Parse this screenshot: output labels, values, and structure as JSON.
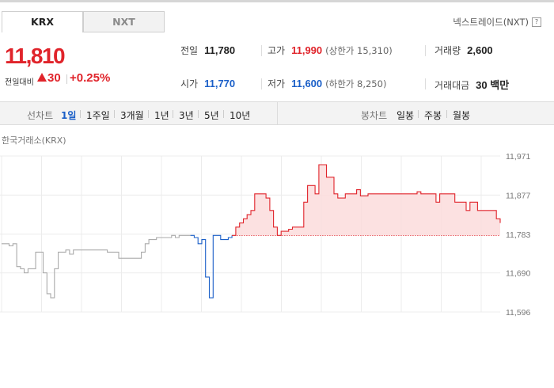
{
  "tabs": {
    "krx": "KRX",
    "nxt": "NXT"
  },
  "nxt_link": {
    "label": "넥스트레이드(NXT)",
    "icon": "?"
  },
  "quote": {
    "price": "11,810",
    "change_label": "전일대비",
    "change_value": "30",
    "change_pct": "+0.25%",
    "up_color": "#e0242b",
    "down_color": "#1a5fc8"
  },
  "stats": {
    "prev_close": {
      "label": "전일",
      "value": "11,780"
    },
    "high": {
      "label": "고가",
      "value": "11,990",
      "sub": "(상한가 15,310)"
    },
    "volume": {
      "label": "거래량",
      "value": "2,600"
    },
    "open": {
      "label": "시가",
      "value": "11,770"
    },
    "low": {
      "label": "저가",
      "value": "11,600",
      "sub": "(하한가 8,250)"
    },
    "amount": {
      "label": "거래대금",
      "value": "30 백만"
    }
  },
  "toolbar": {
    "line_label": "선차트",
    "line_periods": [
      "1일",
      "1주일",
      "3개월",
      "1년",
      "3년",
      "5년",
      "10년"
    ],
    "active_period": "1일",
    "candle_label": "봉차트",
    "candle_periods": [
      "일봉",
      "주봉",
      "월봉"
    ]
  },
  "exchange_label": "한국거래소(KRX)",
  "chart_data": {
    "type": "line",
    "title": "",
    "y_ticks": [
      "11,971",
      "11,877",
      "11,783",
      "11,690",
      "11,596"
    ],
    "ylim": [
      11596,
      11971
    ],
    "baseline": 11780,
    "grid": true,
    "series": [
      {
        "name": "",
        "segment": "before-session",
        "color": "#aaaaaa",
        "values": [
          11760,
          11760,
          11755,
          11760,
          11705,
          11700,
          11690,
          11700,
          11700,
          11740,
          11740,
          11690,
          11640,
          11630,
          11700,
          11740,
          11740,
          11745,
          11735,
          11745,
          11745,
          11745,
          11745,
          11745,
          11745,
          11745,
          11745,
          11745,
          11740,
          11740,
          11740,
          11725,
          11725,
          11725,
          11725,
          11725,
          11725,
          11740,
          11760,
          11770,
          11770,
          11775,
          11775,
          11775,
          11775,
          11780,
          11775,
          11780,
          11780,
          11780,
          11780
        ]
      },
      {
        "name": "",
        "segment": "open-dip",
        "color": "#1a5fc8",
        "values": [
          11780,
          11775,
          11760,
          11770,
          11680,
          11630,
          11780,
          11780,
          11770,
          11770,
          11775,
          11780
        ]
      },
      {
        "name": "",
        "segment": "session",
        "color": "#e0242b",
        "values": [
          11780,
          11800,
          11810,
          11820,
          11830,
          11840,
          11880,
          11880,
          11880,
          11870,
          11840,
          11800,
          11780,
          11790,
          11790,
          11795,
          11800,
          11800,
          11800,
          11860,
          11900,
          11900,
          11880,
          11950,
          11950,
          11920,
          11920,
          11880,
          11870,
          11870,
          11880,
          11880,
          11880,
          11890,
          11875,
          11875,
          11880,
          11880,
          11880,
          11880,
          11880,
          11880,
          11880,
          11880,
          11880,
          11880,
          11880,
          11880,
          11880,
          11885,
          11880,
          11880,
          11880,
          11880,
          11860,
          11880,
          11880,
          11880,
          11880,
          11860,
          11860,
          11860,
          11840,
          11860,
          11860,
          11840,
          11840,
          11840,
          11840,
          11840,
          11820,
          11810
        ]
      }
    ]
  }
}
